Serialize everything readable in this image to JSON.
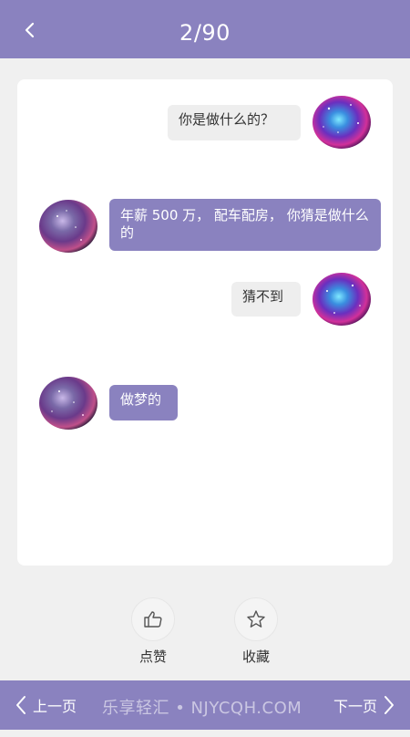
{
  "header": {
    "title": "2/90"
  },
  "conversation": [
    {
      "side": "right",
      "style": "gray",
      "text": "你是做什么的？"
    },
    {
      "side": "left",
      "style": "purple",
      "text": "年薪 500 万， 配车配房， 你猜是做什么的"
    },
    {
      "side": "right",
      "style": "gray",
      "text": "猜不到"
    },
    {
      "side": "left",
      "style": "purple",
      "text": "做梦的"
    }
  ],
  "actions": {
    "like_label": "点赞",
    "favorite_label": "收藏"
  },
  "footer": {
    "prev_label": "上一页",
    "next_label": "下一页",
    "watermark": "乐享轻汇 • NJYCQH.COM"
  },
  "colors": {
    "accent": "#8a82bf",
    "bubble_gray": "#eeeeee",
    "background": "#f0f0f0"
  },
  "icons": [
    "chevron-left-icon",
    "thumbs-up-icon",
    "star-icon",
    "chevron-right-icon"
  ]
}
